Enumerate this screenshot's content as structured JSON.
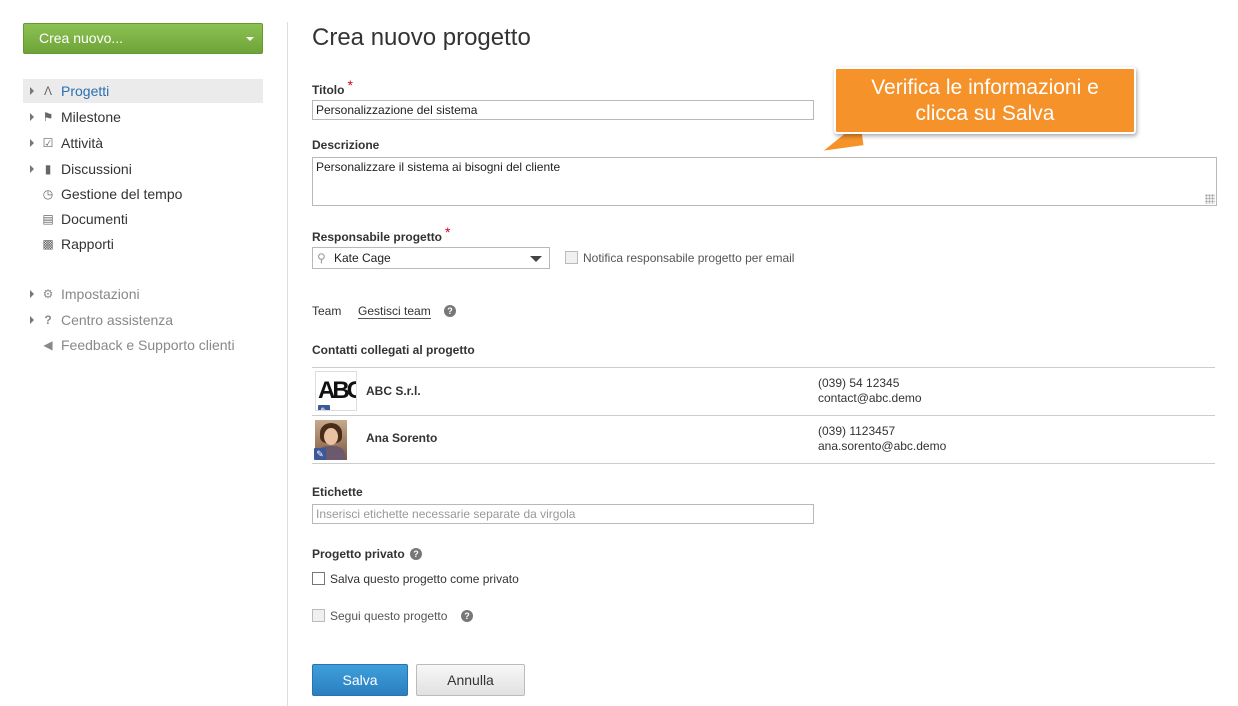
{
  "sidebar": {
    "create_button": "Crea nuovo...",
    "items": [
      {
        "label": "Progetti",
        "icon": "project-icon"
      },
      {
        "label": "Milestone",
        "icon": "flag-icon"
      },
      {
        "label": "Attività",
        "icon": "checkbox-icon"
      },
      {
        "label": "Discussioni",
        "icon": "comment-icon"
      },
      {
        "label": "Gestione del tempo",
        "icon": "clock-icon"
      },
      {
        "label": "Documenti",
        "icon": "document-icon"
      },
      {
        "label": "Rapporti",
        "icon": "chart-icon"
      },
      {
        "label": "Impostazioni",
        "icon": "gear-icon"
      },
      {
        "label": "Centro assistenza",
        "icon": "question-icon"
      },
      {
        "label": "Feedback e Supporto clienti",
        "icon": "megaphone-icon"
      }
    ]
  },
  "form": {
    "title": "Crea nuovo progetto",
    "title_label": "Titolo",
    "title_value": "Personalizzazione del sistema",
    "description_label": "Descrizione",
    "description_value": "Personalizzare il sistema ai bisogni del cliente",
    "manager_label": "Responsabile progetto",
    "manager_value": "Kate Cage",
    "notify_label": "Notifica responsabile progetto per email",
    "team_label": "Team",
    "team_link": "Gestisci team",
    "contacts_label": "Contatti collegati al progetto",
    "contacts": [
      {
        "name": "ABC S.r.l.",
        "phone": "(039) 54 12345",
        "email": "contact@abc.demo",
        "logo": "ABC"
      },
      {
        "name": "Ana Sorento",
        "phone": "(039) 1123457",
        "email": "ana.sorento@abc.demo"
      }
    ],
    "tags_label": "Etichette",
    "tags_placeholder": "Inserisci etichette necessarie separate da virgola",
    "private_label": "Progetto privato",
    "private_checkbox": "Salva questo progetto come privato",
    "follow_checkbox": "Segui questo progetto",
    "save_button": "Salva",
    "cancel_button": "Annulla",
    "required_mark": "*"
  },
  "callout": {
    "line1": "Verifica le informazioni e",
    "line2": "clicca su Salva"
  },
  "colors": {
    "create_button": "#7cb342",
    "primary_button": "#2a7fbf",
    "callout": "#f5922a",
    "required": "#d0021b"
  }
}
